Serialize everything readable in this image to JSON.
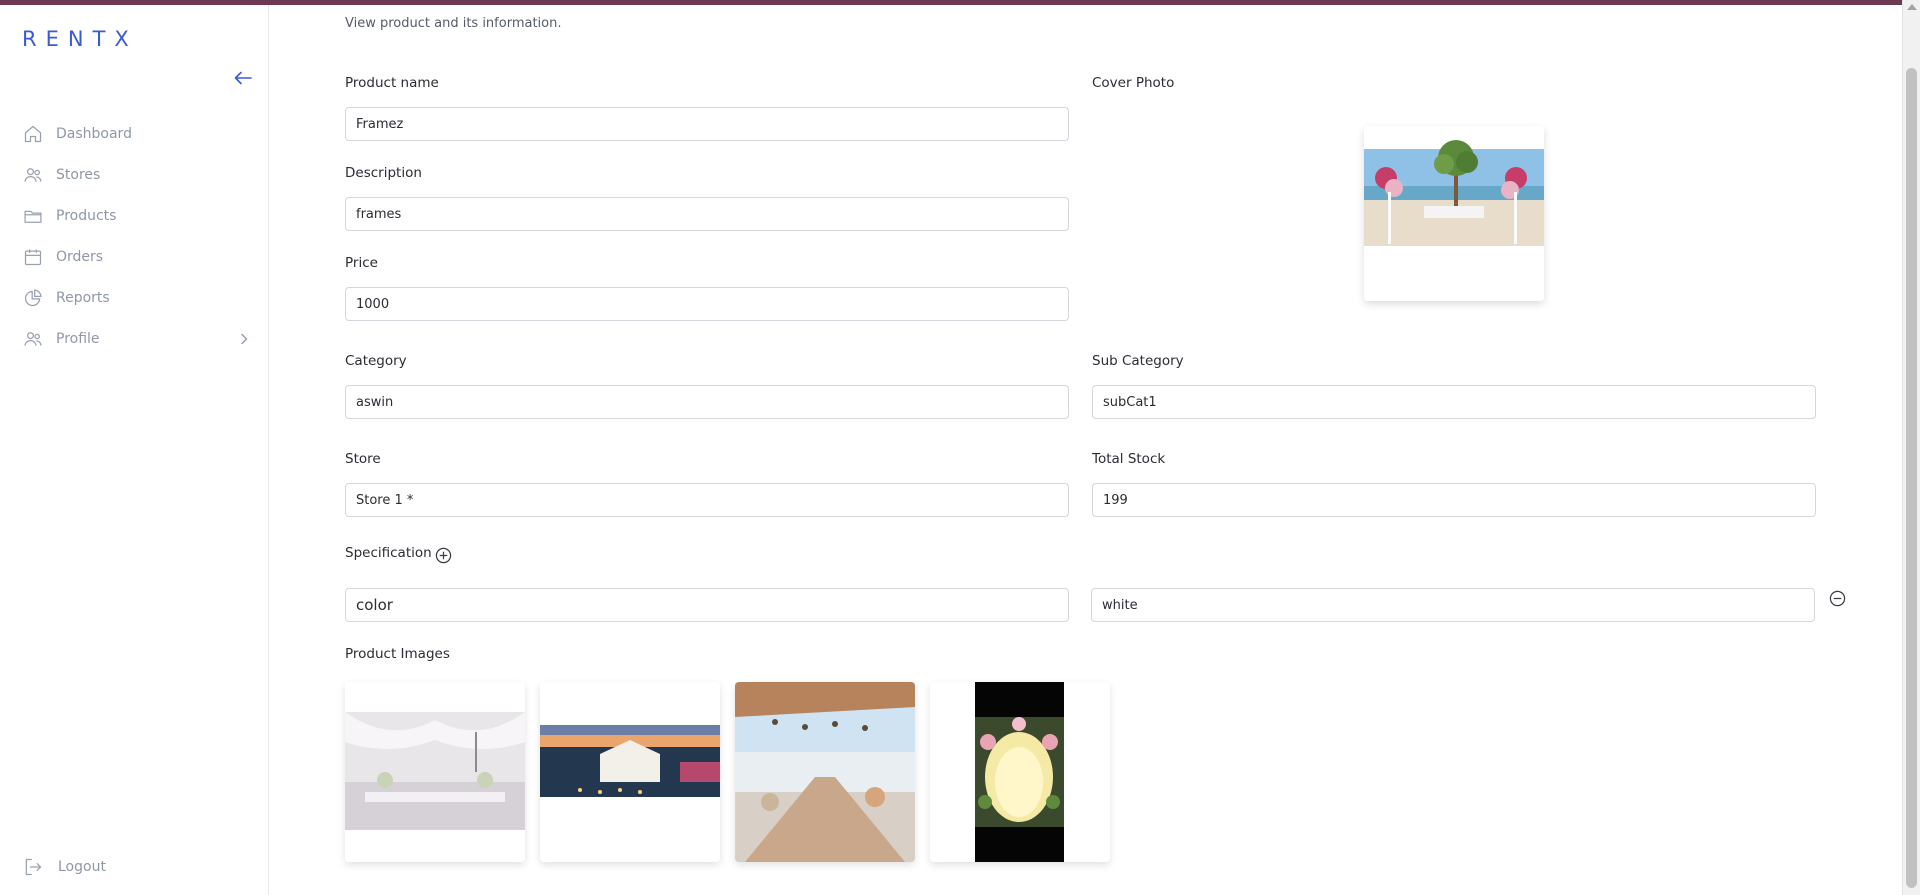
{
  "brand": {
    "logo_text": "RENTX",
    "accent_color": "#3b5bd6",
    "topbar_color": "#6b3a52"
  },
  "sidebar": {
    "collapse_icon": "arrow-left-icon",
    "items": [
      {
        "label": "Dashboard",
        "icon": "home-icon"
      },
      {
        "label": "Stores",
        "icon": "users-icon"
      },
      {
        "label": "Products",
        "icon": "folder-icon"
      },
      {
        "label": "Orders",
        "icon": "calendar-icon"
      },
      {
        "label": "Reports",
        "icon": "pie-chart-icon"
      },
      {
        "label": "Profile",
        "icon": "user-group-icon",
        "has_submenu": true
      }
    ],
    "logout_label": "Logout"
  },
  "page": {
    "subtitle": "View product and its information."
  },
  "form": {
    "product_name": {
      "label": "Product name",
      "value": "Framez"
    },
    "description": {
      "label": "Description",
      "value": "frames"
    },
    "price": {
      "label": "Price",
      "value": "1000"
    },
    "cover_photo": {
      "label": "Cover Photo"
    },
    "category": {
      "label": "Category",
      "value": "aswin"
    },
    "sub_category": {
      "label": "Sub Category",
      "value": "subCat1"
    },
    "store": {
      "label": "Store",
      "value": "Store 1 *"
    },
    "total_stock": {
      "label": "Total Stock",
      "value": "199"
    },
    "specification": {
      "label": "Specification",
      "rows": [
        {
          "key": "color",
          "value": "white"
        }
      ]
    },
    "product_images": {
      "label": "Product Images"
    }
  }
}
